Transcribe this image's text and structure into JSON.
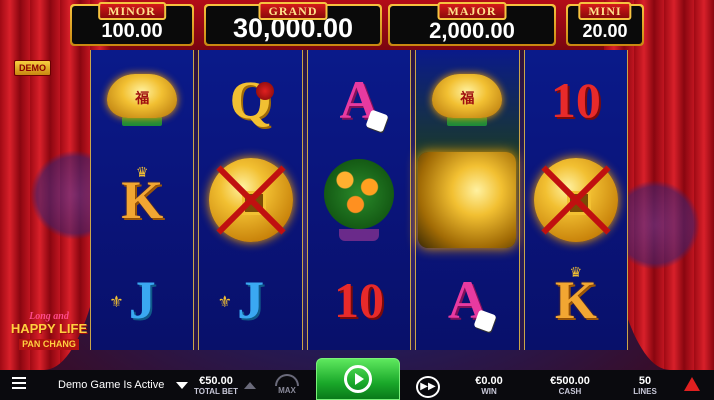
{
  "jackpots": {
    "minor": {
      "label": "MINOR",
      "value": "100.00"
    },
    "grand": {
      "label": "GRAND",
      "value": "30,000.00"
    },
    "major": {
      "label": "MAJOR",
      "value": "2,000.00"
    },
    "mini": {
      "label": "MINI",
      "value": "20.00"
    }
  },
  "demo_badge": "DEMO",
  "reels": [
    [
      "gold-ingot",
      "K",
      "J"
    ],
    [
      "Q",
      "lucky-coin",
      "J"
    ],
    [
      "A",
      "orange-tree",
      "10"
    ],
    [
      "gold-ingot",
      "dragon-wild",
      "A"
    ],
    [
      "10",
      "lucky-coin",
      "K"
    ]
  ],
  "symbols": {
    "k": "K",
    "q": "Q",
    "a": "A",
    "j": "J",
    "ten": "10"
  },
  "logo": {
    "line1": "Long and",
    "line2": "HAPPY LIFE",
    "line3": "PAN CHANG"
  },
  "bottom_bar": {
    "status": "Demo Game Is Active",
    "total_bet_value": "€50.00",
    "total_bet_label": "TOTAL BET",
    "max_label": "MAX",
    "win_value": "€0.00",
    "win_label": "WIN",
    "cash_value": "€500.00",
    "cash_label": "CASH",
    "lines_value": "50",
    "lines_label": "LINES"
  },
  "colors": {
    "curtain": "#c01520",
    "reel_bg": "#0a147a",
    "gold": "#f2c032",
    "spin_green": "#1aa82a"
  }
}
